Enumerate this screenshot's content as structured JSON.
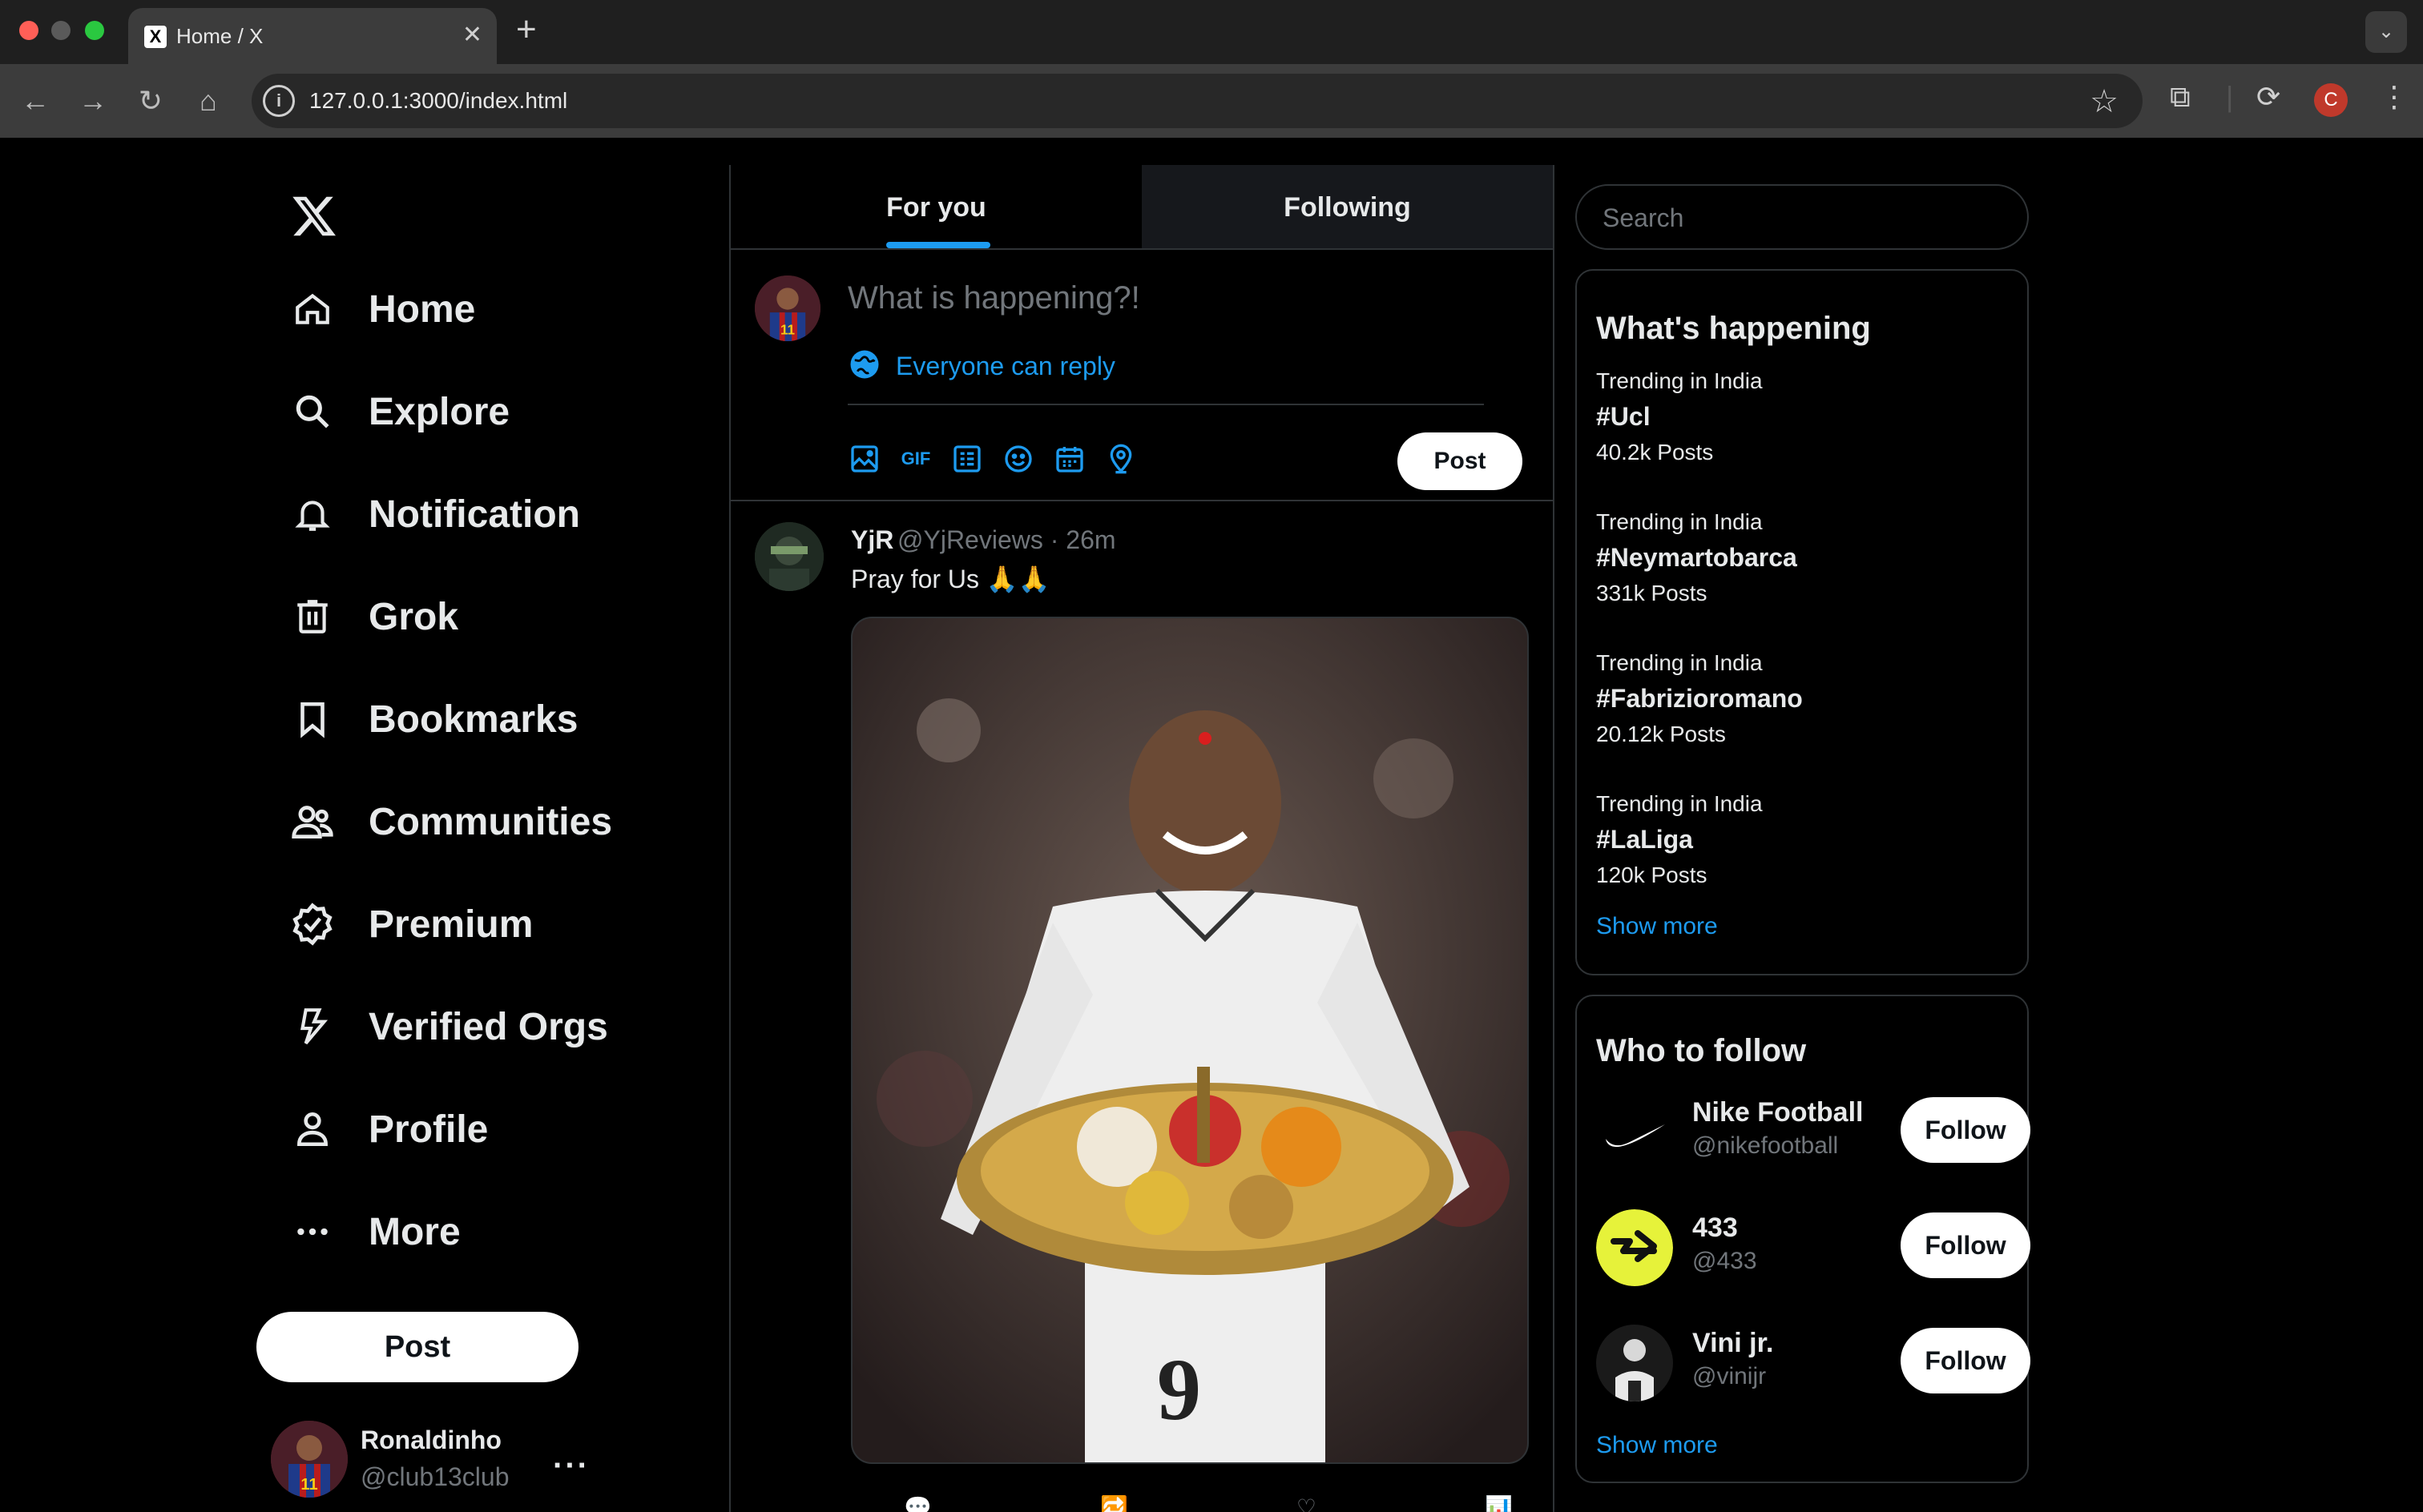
{
  "browser": {
    "tab_title": "Home / X",
    "tab_favicon": "X",
    "url": "127.0.0.1:3000/index.html",
    "profile_initial": "C"
  },
  "sidebar": {
    "logo": "x-logo",
    "items": [
      {
        "label": "Home",
        "icon": "home-icon"
      },
      {
        "label": "Explore",
        "icon": "search-icon"
      },
      {
        "label": "Notification",
        "icon": "bell-icon"
      },
      {
        "label": "Grok",
        "icon": "grok-icon"
      },
      {
        "label": "Bookmarks",
        "icon": "bookmark-icon"
      },
      {
        "label": "Communities",
        "icon": "communities-icon"
      },
      {
        "label": "Premium",
        "icon": "premium-icon"
      },
      {
        "label": "Verified Orgs",
        "icon": "lightning-icon"
      },
      {
        "label": "Profile",
        "icon": "person-icon"
      },
      {
        "label": "More",
        "icon": "more-icon"
      }
    ],
    "post_label": "Post",
    "account": {
      "name": "Ronaldinho",
      "handle": "@club13club",
      "more": "···"
    }
  },
  "main": {
    "tabs": [
      {
        "label": "For you",
        "active": true
      },
      {
        "label": "Following",
        "active": false
      }
    ],
    "compose": {
      "placeholder": "What is happening?!",
      "reply_setting": "Everyone can reply",
      "post_label": "Post",
      "tools": [
        "image-icon",
        "gif-icon",
        "poll-icon",
        "emoji-icon",
        "schedule-icon",
        "location-icon"
      ],
      "gif_text": "GIF"
    },
    "tweet": {
      "name": "YjR",
      "handle": "@YjReviews",
      "time": "26m",
      "meta": "@YjReviews · 26m",
      "text": "Pray for Us 🙏🙏"
    }
  },
  "right": {
    "search_placeholder": "Search",
    "trends_title": "What's happening",
    "trends": [
      {
        "context": "Trending in India",
        "tag": "#Ucl",
        "count": "40.2k Posts"
      },
      {
        "context": "Trending in India",
        "tag": "#Neymartobarca",
        "count": "331k Posts"
      },
      {
        "context": "Trending in India",
        "tag": "#Fabrizioromano",
        "count": "20.12k Posts"
      },
      {
        "context": "Trending in India",
        "tag": "#LaLiga",
        "count": "120k Posts"
      }
    ],
    "trends_show_more": "Show more",
    "follow_title": "Who to follow",
    "follow": [
      {
        "name": "Nike Football",
        "handle": "@nikefootball",
        "button": "Follow"
      },
      {
        "name": "433",
        "handle": "@433",
        "button": "Follow"
      },
      {
        "name": "Vini jr.",
        "handle": "@vinijr",
        "button": "Follow"
      }
    ],
    "follow_show_more": "Show more"
  },
  "colors": {
    "accent": "#1d9bf0",
    "background": "#000000",
    "border": "#2f3336",
    "muted": "#71767b"
  }
}
